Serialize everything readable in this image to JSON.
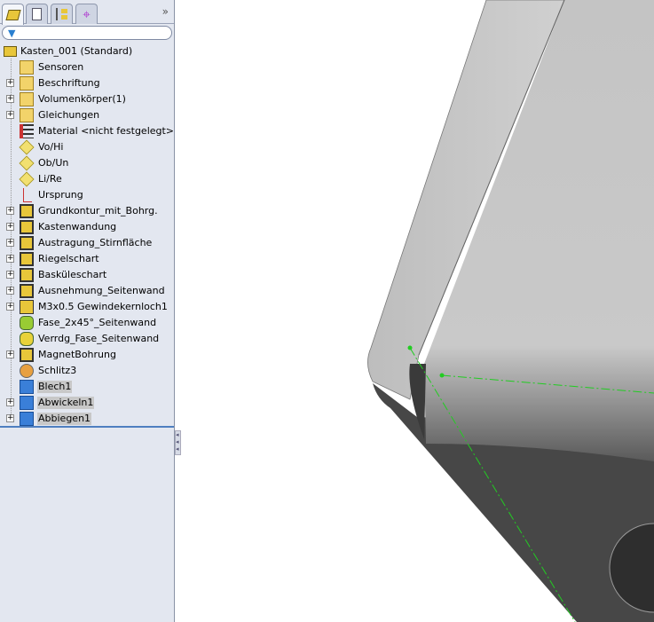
{
  "panel": {
    "tabs": [
      {
        "name": "feature-manager",
        "icon": "part-icon"
      },
      {
        "name": "property-manager",
        "icon": "clipboard-icon"
      },
      {
        "name": "configuration-manager",
        "icon": "configuration-icon"
      },
      {
        "name": "dimxpert-manager",
        "icon": "target-icon"
      }
    ],
    "more": "»",
    "filter_icon": "filter-icon",
    "root": "Kasten_001  (Standard)",
    "items": [
      {
        "label": "Sensoren",
        "expand": false,
        "icon": "sensor-folder-icon"
      },
      {
        "label": "Beschriftung",
        "expand": true,
        "icon": "annotation-folder-icon"
      },
      {
        "label": "Volumenkörper(1)",
        "expand": true,
        "icon": "solid-bodies-folder-icon"
      },
      {
        "label": "Gleichungen",
        "expand": true,
        "icon": "equations-folder-icon"
      },
      {
        "label": "Material <nicht festgelegt>",
        "expand": false,
        "icon": "material-icon"
      },
      {
        "label": "Vo/Hi",
        "expand": false,
        "icon": "plane-icon"
      },
      {
        "label": "Ob/Un",
        "expand": false,
        "icon": "plane-icon"
      },
      {
        "label": "Li/Re",
        "expand": false,
        "icon": "plane-icon"
      },
      {
        "label": "Ursprung",
        "expand": false,
        "icon": "origin-icon"
      },
      {
        "label": "Grundkontur_mit_Bohrg.",
        "expand": true,
        "icon": "extrude-icon"
      },
      {
        "label": "Kastenwandung",
        "expand": true,
        "icon": "extrude-icon"
      },
      {
        "label": "Austragung_Stirnfläche",
        "expand": true,
        "icon": "extrude-icon"
      },
      {
        "label": "Riegelschart",
        "expand": true,
        "icon": "extrude-icon"
      },
      {
        "label": "Basküleschart",
        "expand": true,
        "icon": "extrude-icon"
      },
      {
        "label": "Ausnehmung_Seitenwand",
        "expand": true,
        "icon": "extrude-icon"
      },
      {
        "label": "M3x0.5 Gewindekernloch1",
        "expand": true,
        "icon": "hole-wizard-icon"
      },
      {
        "label": "Fase_2x45°_Seitenwand",
        "expand": false,
        "icon": "chamfer-icon"
      },
      {
        "label": "Verrdg_Fase_Seitenwand",
        "expand": false,
        "icon": "fillet-icon"
      },
      {
        "label": "MagnetBohrung",
        "expand": true,
        "icon": "extrude-icon"
      },
      {
        "label": "Schlitz3",
        "expand": false,
        "icon": "rip-icon"
      },
      {
        "label": "Blech1",
        "expand": false,
        "icon": "sheet-metal-icon",
        "selected": true
      },
      {
        "label": "Abwickeln1",
        "expand": true,
        "icon": "unfold-icon",
        "selected": true
      },
      {
        "label": "Abbiegen1",
        "expand": true,
        "icon": "fold-icon",
        "selected": true
      }
    ]
  },
  "colors": {
    "panel": "#e3e7f0",
    "sketch": "#22cc22",
    "face_light": "#c8c8c8",
    "face_dark": "#444444"
  }
}
